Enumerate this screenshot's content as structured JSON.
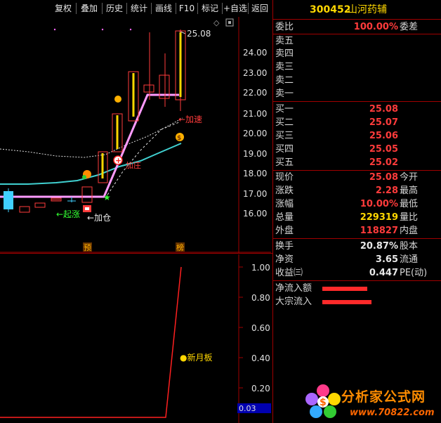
{
  "toolbar": {
    "buttons": [
      "复权",
      "叠加",
      "历史",
      "统计",
      "画线",
      "F10",
      "标记",
      "+自选",
      "返回"
    ]
  },
  "main_chart": {
    "price_ticks": [
      "25.08",
      "24.00",
      "23.00",
      "22.00",
      "21.00",
      "20.00",
      "19.00",
      "18.00",
      "17.00",
      "16.00"
    ],
    "annotations": {
      "speed_up": "←加速",
      "rise_start": "←起涨",
      "add_position": "←加仓",
      "red_tag": "加庄"
    },
    "markers": [
      "预",
      "榜"
    ]
  },
  "sub_chart": {
    "ticks": [
      "1.00",
      "0.80",
      "0.60",
      "0.40",
      "0.20"
    ],
    "current_value": "0.03",
    "label": "●新月板"
  },
  "quote": {
    "code": "300452",
    "name": "山河药辅",
    "weibi_label": "委比",
    "weibi_value": "100.00%",
    "weicha_label": "委差",
    "sells": [
      {
        "label": "卖五"
      },
      {
        "label": "卖四"
      },
      {
        "label": "卖三"
      },
      {
        "label": "卖二"
      },
      {
        "label": "卖一"
      }
    ],
    "buys": [
      {
        "label": "买一",
        "price": "25.08"
      },
      {
        "label": "买二",
        "price": "25.07"
      },
      {
        "label": "买三",
        "price": "25.06"
      },
      {
        "label": "买四",
        "price": "25.05"
      },
      {
        "label": "买五",
        "price": "25.02"
      }
    ],
    "stats": [
      {
        "label": "现价",
        "value": "25.08",
        "label2": "今开",
        "color": "red"
      },
      {
        "label": "涨跌",
        "value": "2.28",
        "label2": "最高",
        "color": "red"
      },
      {
        "label": "涨幅",
        "value": "10.00%",
        "label2": "最低",
        "color": "red"
      },
      {
        "label": "总量",
        "value": "229319",
        "label2": "量比",
        "color": "yellow"
      },
      {
        "label": "外盘",
        "value": "118827",
        "label2": "内盘",
        "color": "red"
      }
    ],
    "extra": [
      {
        "label": "换手",
        "value": "20.87%",
        "label2": "股本"
      },
      {
        "label": "净资",
        "value": "3.65",
        "label2": "流通"
      },
      {
        "label": "收益㈢",
        "value": "0.447",
        "label2": "PE(动)"
      }
    ],
    "flows": [
      {
        "label": "净流入额"
      },
      {
        "label": "大宗流入"
      }
    ]
  },
  "logo": {
    "title": "分析家公式网",
    "url": "www.70822.com"
  },
  "colors": {
    "up": "#ff3b3b",
    "down": "#00e5ff",
    "accent": "#ffd700",
    "ma_white": "#ff9bff",
    "ma_cyan": "#40d0d0"
  }
}
